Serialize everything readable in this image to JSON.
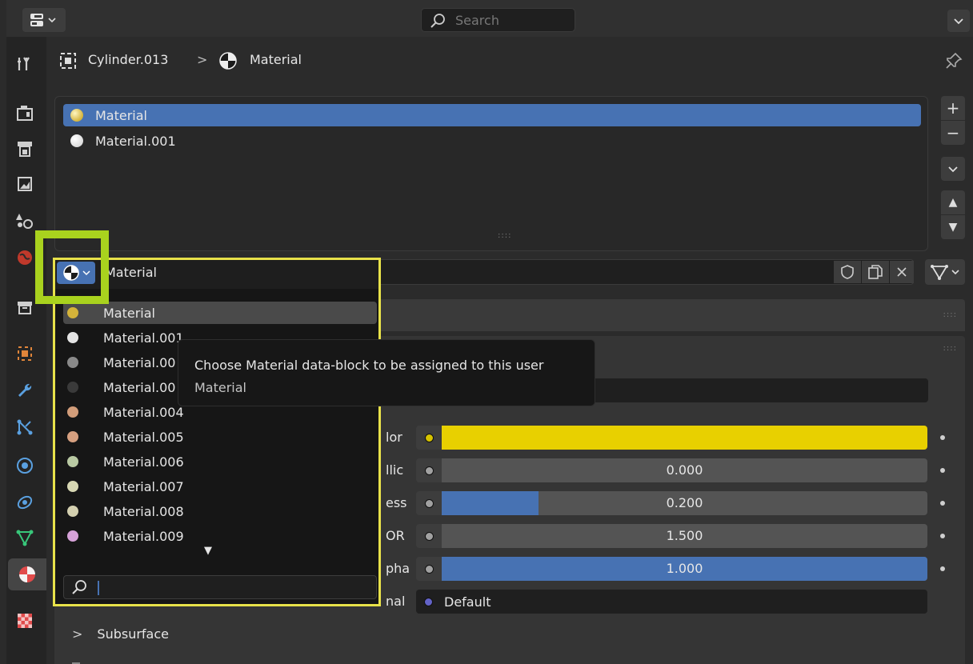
{
  "header": {
    "editor_type_icon": "properties-editor-icon",
    "search_placeholder": "Search"
  },
  "tabs": [
    {
      "name": "tool-icon"
    },
    {
      "name": "render-icon"
    },
    {
      "name": "output-icon"
    },
    {
      "name": "view-layer-icon"
    },
    {
      "name": "scene-icon"
    },
    {
      "name": "world-icon"
    },
    {
      "name": "collection-icon"
    },
    {
      "name": "object-icon"
    },
    {
      "name": "modifier-icon"
    },
    {
      "name": "particles-icon"
    },
    {
      "name": "physics-icon"
    },
    {
      "name": "constraints-icon"
    },
    {
      "name": "object-data-icon"
    },
    {
      "name": "material-icon"
    },
    {
      "name": "texture-icon"
    }
  ],
  "breadcrumb": {
    "object": "Cylinder.013",
    "separator": ">",
    "material": "Material"
  },
  "slots": [
    {
      "label": "Material",
      "color": "#d4b33a",
      "selected": true
    },
    {
      "label": "Material.001",
      "color": "#dcdcdc",
      "selected": false
    }
  ],
  "slot_buttons": {
    "add": "+",
    "remove": "−",
    "up": "▲",
    "down": "▼"
  },
  "datablock": {
    "name": "Material"
  },
  "dropdown": {
    "items": [
      {
        "label": "Material",
        "color": "#d4b33a"
      },
      {
        "label": "Material.001",
        "color": "#e4e4e4"
      },
      {
        "label": "Material.00",
        "color": "#8a8a8a"
      },
      {
        "label": "Material.00",
        "color": "#3a3a3a"
      },
      {
        "label": "Material.004",
        "color": "#d29d7a"
      },
      {
        "label": "Material.005",
        "color": "#d6a080"
      },
      {
        "label": "Material.006",
        "color": "#b9c9a3"
      },
      {
        "label": "Material.007",
        "color": "#d8d8b4"
      },
      {
        "label": "Material.008",
        "color": "#d4d0b0"
      },
      {
        "label": "Material.009",
        "color": "#d6a2d8"
      }
    ],
    "more_indicator": "▼",
    "search_value": ""
  },
  "tooltip": {
    "description": "Choose Material data-block to be assigned to this user",
    "python": "Material"
  },
  "surface": {
    "properties": [
      {
        "label": "lor",
        "kind": "color",
        "color": "#e8d000",
        "socket_color": "#d6c300"
      },
      {
        "label": "llic",
        "kind": "value",
        "value": "0.000",
        "fraction": 0.0,
        "socket_color": "#a1a1a1"
      },
      {
        "label": "ess",
        "kind": "value",
        "value": "0.200",
        "fraction": 0.2,
        "socket_color": "#a1a1a1"
      },
      {
        "label": "OR",
        "kind": "value",
        "value": "1.500",
        "fraction": 0.0,
        "socket_color": "#a1a1a1"
      },
      {
        "label": "pha",
        "kind": "value",
        "value": "1.000",
        "fraction": 1.0,
        "socket_color": "#a1a1a1"
      },
      {
        "label": "nal",
        "kind": "normal",
        "value": "Default",
        "socket_color": "#6363c7"
      }
    ]
  },
  "subpanels": [
    {
      "label": "Subsurface",
      "chevron": ">"
    }
  ]
}
